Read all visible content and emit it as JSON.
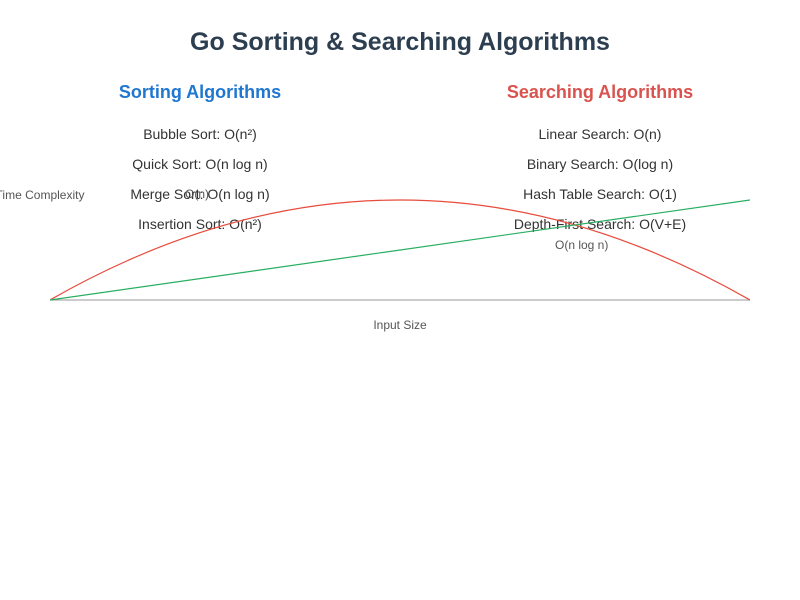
{
  "title": "Go Sorting & Searching Algorithms",
  "columns": {
    "sorting": {
      "header": "Sorting Algorithms",
      "items": [
        "Bubble Sort: O(n²)",
        "Quick Sort: O(n log n)",
        "Merge Sort: O(n log n)",
        "Insertion Sort: O(n²)"
      ]
    },
    "searching": {
      "header": "Searching Algorithms",
      "items": [
        "Linear Search: O(n)",
        "Binary Search: O(log n)",
        "Hash Table Search: O(1)",
        "Depth-First Search: O(V+E)"
      ]
    }
  },
  "chart_data": {
    "type": "line",
    "title": "",
    "xlabel": "Input Size",
    "ylabel": "Time Complexity",
    "xlim": [
      0,
      1
    ],
    "ylim": [
      0,
      1
    ],
    "series": [
      {
        "name": "O(n)",
        "color_hint": "red/arc",
        "x": [
          0,
          0.25,
          0.5,
          0.75,
          1
        ],
        "y": [
          0,
          0.75,
          1.0,
          0.75,
          0
        ]
      },
      {
        "name": "O(n log n)",
        "color_hint": "green/linear",
        "x": [
          0,
          1
        ],
        "y": [
          0,
          1
        ]
      }
    ],
    "annotations": [
      {
        "text": "O(n)",
        "x": 0.22,
        "y": 0.75
      },
      {
        "text": "O(n log n)",
        "x": 0.78,
        "y": 0.5
      }
    ]
  },
  "colors": {
    "title": "#2c3e50",
    "sorting_header": "#1f77d0",
    "searching_header": "#d9534f",
    "axis": "#999",
    "curve_arc": "#e74c3c",
    "curve_line": "#27ae60"
  }
}
